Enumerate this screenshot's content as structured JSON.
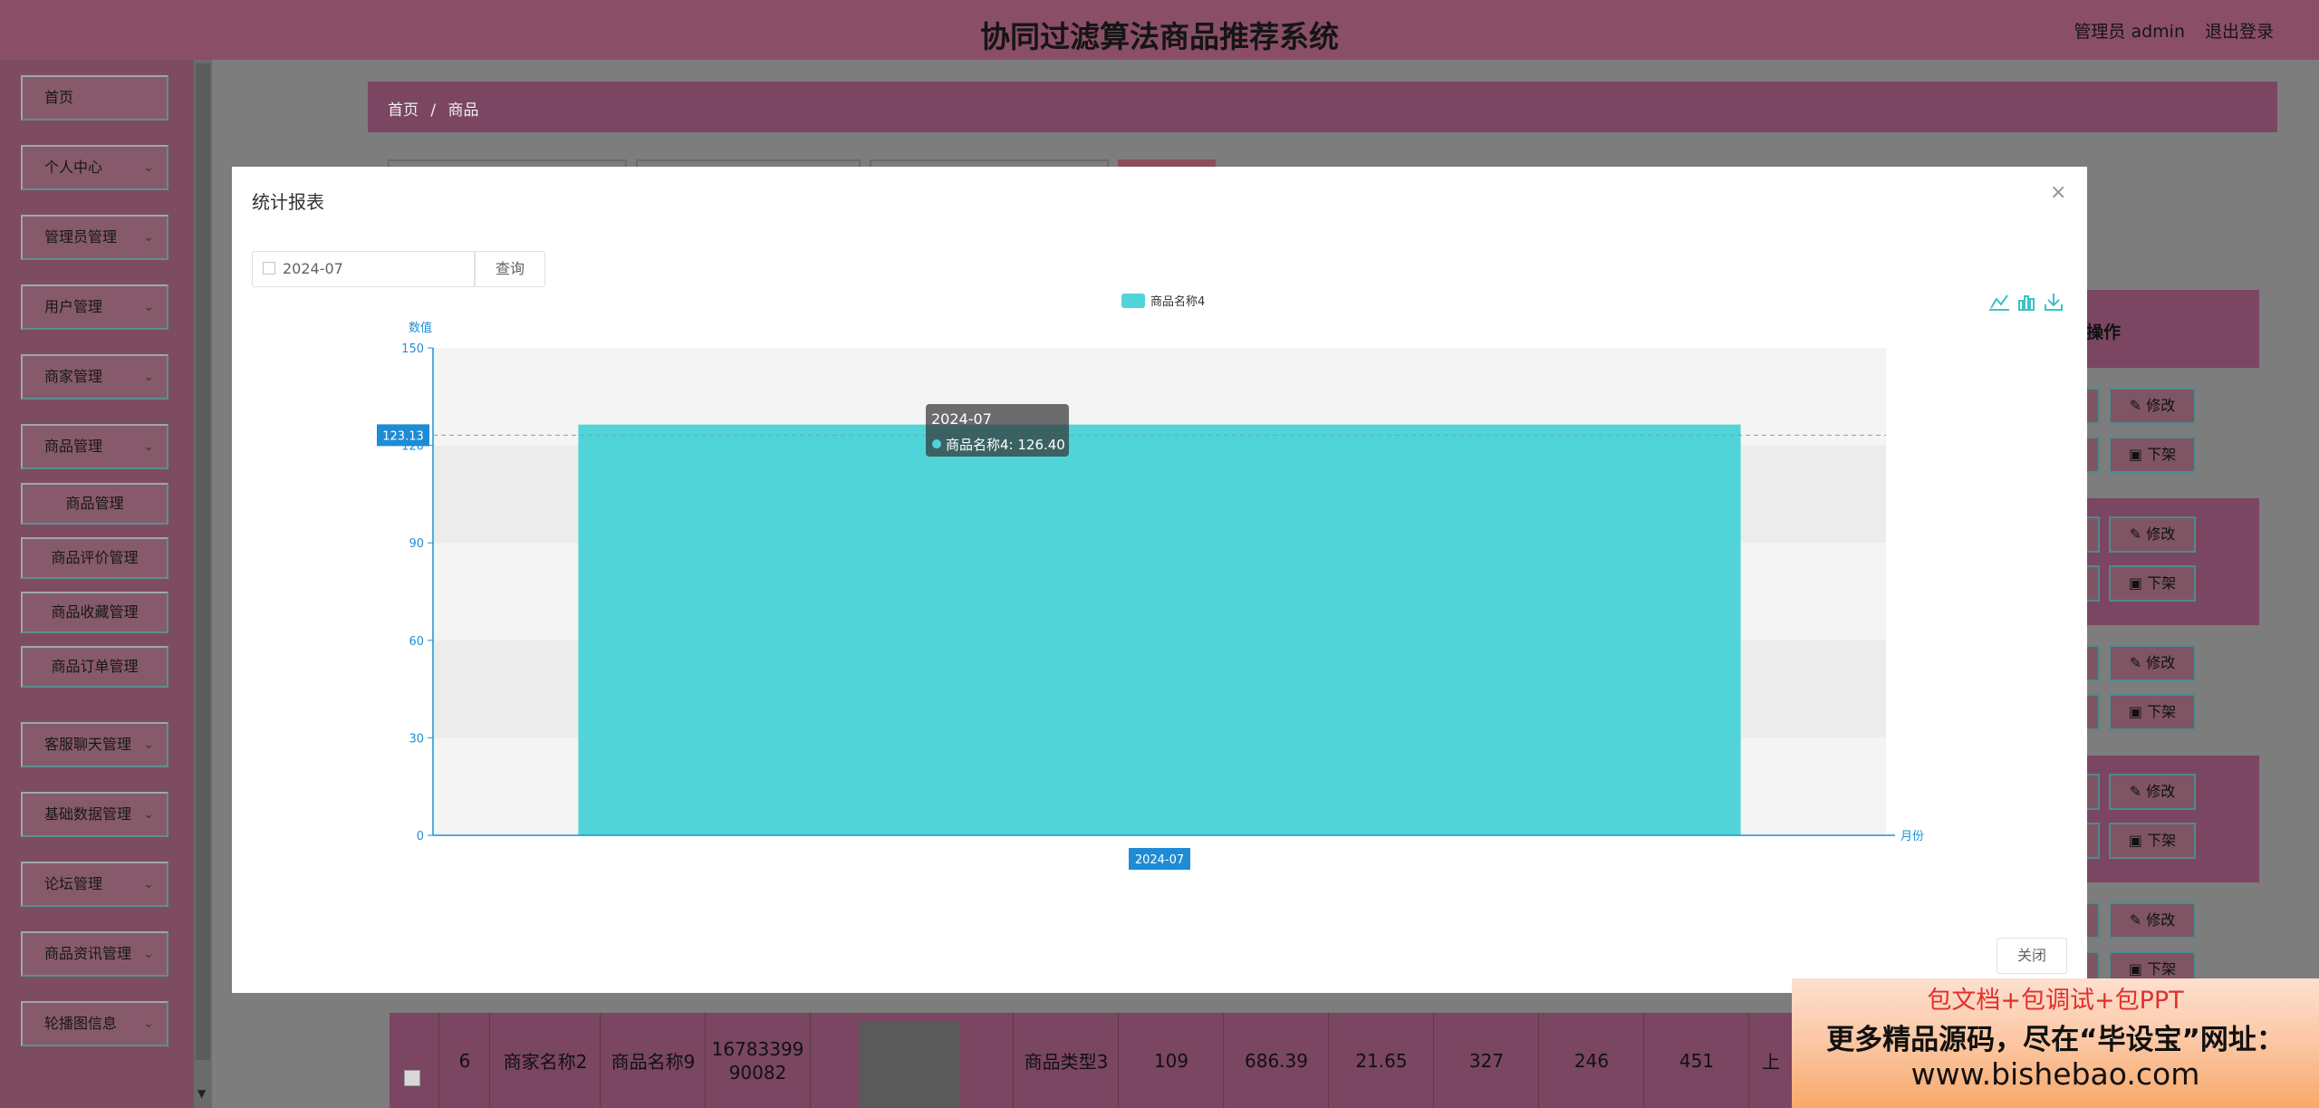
{
  "header": {
    "title": "协同过滤算法商品推荐系统",
    "user": "管理员 admin",
    "logout": "退出登录"
  },
  "sidebar": {
    "items": [
      {
        "label": "首页"
      },
      {
        "label": "个人中心",
        "chevron": "⌄"
      },
      {
        "label": "管理员管理",
        "chevron": "⌄"
      },
      {
        "label": "用户管理",
        "chevron": "⌄"
      },
      {
        "label": "商家管理",
        "chevron": "⌄"
      },
      {
        "label": "商品管理",
        "chevron": "⌄"
      }
    ],
    "sub_items": [
      {
        "label": "商品管理"
      },
      {
        "label": "商品评价管理"
      },
      {
        "label": "商品收藏管理"
      },
      {
        "label": "商品订单管理"
      }
    ],
    "items_after": [
      {
        "label": "客服聊天管理",
        "chevron": "⌄"
      },
      {
        "label": "基础数据管理",
        "chevron": "⌄"
      },
      {
        "label": "论坛管理",
        "chevron": "⌄"
      },
      {
        "label": "商品资讯管理",
        "chevron": "⌄"
      },
      {
        "label": "轮播图信息",
        "chevron": "⌄"
      }
    ]
  },
  "breadcrumb": {
    "home": "首页",
    "sep": "/",
    "current": "商品"
  },
  "ops": {
    "title": "操作",
    "edit_label": "✎ 修改",
    "offshelf_label": "▣ 下架"
  },
  "table_row": {
    "index": "6",
    "merchant": "商家名称2",
    "product": "商品名称9",
    "code": "16783399 90082",
    "type": "商品类型3",
    "c1": "109",
    "c2": "686.39",
    "c3": "21.65",
    "c4": "327",
    "c5": "246",
    "c6": "451",
    "c7": "上"
  },
  "modal": {
    "title": "统计报表",
    "close_icon": "×",
    "date_value": "2024-07",
    "query_label": "查询",
    "close_label": "关闭"
  },
  "chart_data": {
    "type": "bar",
    "categories": [
      "2024-07"
    ],
    "series": [
      {
        "name": "商品名称4",
        "values": [
          126.4
        ],
        "color": "#50d4d8"
      }
    ],
    "ylabel": "数值",
    "xlabel": "月份",
    "ylim": [
      0,
      150
    ],
    "yticks": [
      0,
      30,
      60,
      90,
      120,
      150
    ],
    "axis_pointer_value": "123.13",
    "axis_pointer_category": "2024-07",
    "tooltip_title": "2024-07",
    "tooltip_text": "商品名称4: 126.40",
    "legend_position": "top-center",
    "axis_color": "#1e90d6"
  },
  "ad": {
    "line1": "包文档+包调试+包PPT",
    "line2": "更多精品源码，尽在“毕设宝”网址：",
    "line3": "www.bishebao.com"
  }
}
